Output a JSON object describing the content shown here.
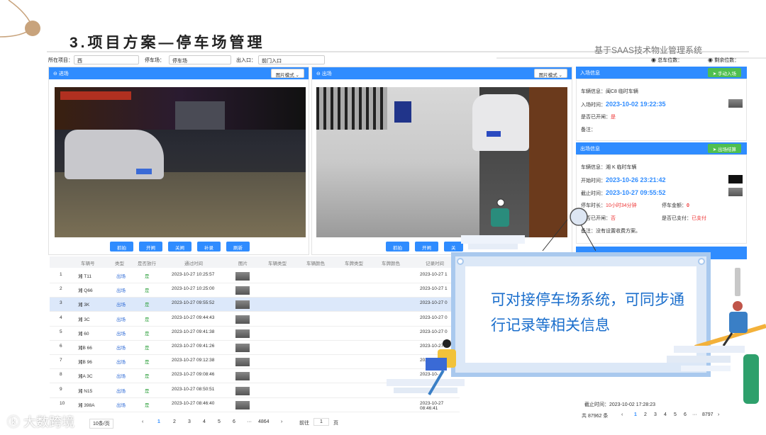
{
  "slide": {
    "title": "3.项目方案—停车场管理",
    "subtitle": "基于SAAS技术物业管理系统"
  },
  "filters": {
    "project_label": "所在项目：",
    "project_value": "西",
    "lot_label": "停车场：",
    "lot_value": "停车场",
    "gate_label": "出入口：",
    "gate_value": "前门入口",
    "total_spaces": "总车位数：",
    "remaining_spaces": "剩余位数："
  },
  "entry": {
    "title": "进场",
    "mode": "图片模式",
    "buttons": [
      "抓拍",
      "开闸",
      "关闸",
      "补录",
      "刷新"
    ]
  },
  "exit": {
    "title": "出场",
    "mode": "图片模式",
    "buttons": [
      "抓拍",
      "开闸",
      "关"
    ]
  },
  "entry_info": {
    "title": "入场信息",
    "action": "手动入场",
    "vehicle_label": "车辆信息：",
    "vehicle_value": "闽C8 临时车辆",
    "time_label": "入场时间：",
    "time_value": "2023-10-02 19:22:35",
    "open_label": "是否已开闸：",
    "open_value": "是",
    "note_label": "备注："
  },
  "exit_info": {
    "title": "出场信息",
    "action": "出场结算",
    "vehicle_label": "车辆信息：",
    "vehicle_value": "湘 K 临时车辆",
    "start_label": "开始时间：",
    "start_value": "2023-10-26 23:21:42",
    "end_label": "截止时间：",
    "end_value": "2023-10-27 09:55:52",
    "duration_label": "停车时长：",
    "duration_value": "10小时34分钟",
    "fee_label": "停车金额：",
    "fee_value": "0",
    "open_label": "是否已开闸：",
    "open_value": "否",
    "paid_label": "是否已支付：",
    "paid_value": "已支付",
    "note_text": "备注：没有设置收费方案。"
  },
  "table": {
    "headers": [
      "车辆号",
      "类型",
      "是否放行",
      "通过时间",
      "图片",
      "车辆类型",
      "车辆颜色",
      "车牌类型",
      "车牌颜色",
      "记录时间"
    ],
    "rows": [
      {
        "no": "1",
        "plate": "湘 T11",
        "type": "出场",
        "pass": "是",
        "time": "2023-10-27 10:25:57",
        "rec": "2023-10-27 1"
      },
      {
        "no": "2",
        "plate": "湘 Q66",
        "type": "出场",
        "pass": "是",
        "time": "2023-10-27 10:25:00",
        "rec": "2023-10-27 1"
      },
      {
        "no": "3",
        "plate": "湘 3K",
        "type": "出场",
        "pass": "是",
        "time": "2023-10-27 09:55:52",
        "rec": "2023-10-27 0"
      },
      {
        "no": "4",
        "plate": "湘 3C",
        "type": "出场",
        "pass": "是",
        "time": "2023-10-27 09:44:43",
        "rec": "2023-10-27 0"
      },
      {
        "no": "5",
        "plate": "湘 60",
        "type": "出场",
        "pass": "是",
        "time": "2023-10-27 09:41:38",
        "rec": "2023-10-27 0"
      },
      {
        "no": "6",
        "plate": "湘B 66",
        "type": "出场",
        "pass": "是",
        "time": "2023-10-27 09:41:26",
        "rec": "2023-10-27 0"
      },
      {
        "no": "7",
        "plate": "湘B 96",
        "type": "出场",
        "pass": "是",
        "time": "2023-10-27 09:12:38",
        "rec": "2023-10"
      },
      {
        "no": "8",
        "plate": "湘A 3C",
        "type": "出场",
        "pass": "是",
        "time": "2023-10-27 09:08:46",
        "rec": "2023-10-"
      },
      {
        "no": "9",
        "plate": "湘 N15",
        "type": "出场",
        "pass": "是",
        "time": "2023-10-27 08:50:51",
        "rec": ""
      },
      {
        "no": "10",
        "plate": "湘 398A",
        "type": "出场",
        "pass": "是",
        "time": "2023-10-27 08:46:40",
        "rec": "2023-10-27 08:46:41"
      }
    ]
  },
  "pager": {
    "page_size": "10条/页",
    "pages": [
      "1",
      "2",
      "3",
      "4",
      "5",
      "6"
    ],
    "ellipsis": "···",
    "last": "4864",
    "goto": "前往",
    "goto_value": "1",
    "page_unit": "页",
    "prev": "‹",
    "next": "›"
  },
  "side_pager": {
    "total": "共 87962 条",
    "pages": [
      "1",
      "2",
      "3",
      "4",
      "5",
      "6"
    ],
    "ellipsis": "···",
    "last": "8797",
    "prev": "‹",
    "next": "›",
    "last_time": "截止时间：2023-10-02 17:28:23"
  },
  "popup": {
    "text": "可对接停车场系统，可同步通行记录等相关信息"
  },
  "watermark": "大数跨境",
  "colors": {
    "primary": "#2f8cff",
    "accent_green": "#4fbf4f",
    "alert_red": "#e33333"
  }
}
